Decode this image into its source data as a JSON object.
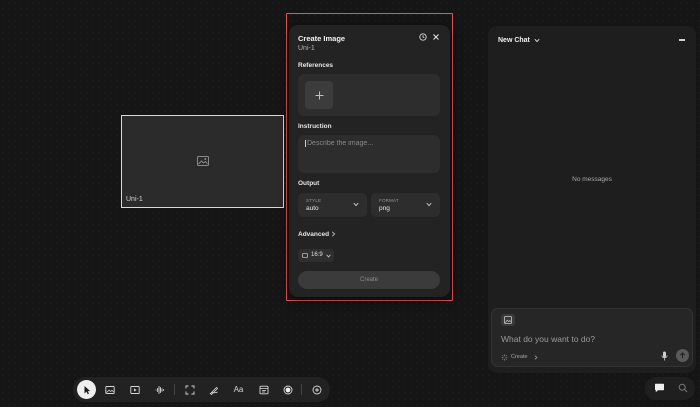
{
  "canvas": {
    "node_label": "Uni-1"
  },
  "create_panel": {
    "title": "Create Image",
    "subtitle": "Uni-1",
    "references_label": "References",
    "instruction_label": "Instruction",
    "instruction_placeholder": "Describe the image...",
    "output_label": "Output",
    "style": {
      "label": "STYLE",
      "value": "auto"
    },
    "format": {
      "label": "FORMAT",
      "value": "png"
    },
    "advanced_label": "Advanced",
    "aspect_ratio": "16:9",
    "create_label": "Create",
    "accent_color": "#e0555a"
  },
  "chat": {
    "title": "New Chat",
    "empty_text": "No messages",
    "input_placeholder": "What do you want to do?",
    "mode_label": "Create"
  },
  "toolbar": {
    "tools": [
      "pointer-icon",
      "image-icon",
      "video-icon",
      "audio-icon",
      "frame-icon",
      "draw-icon",
      "text-tool",
      "note-icon",
      "record-icon",
      "add-icon"
    ],
    "text_tool_label": "Aa"
  }
}
